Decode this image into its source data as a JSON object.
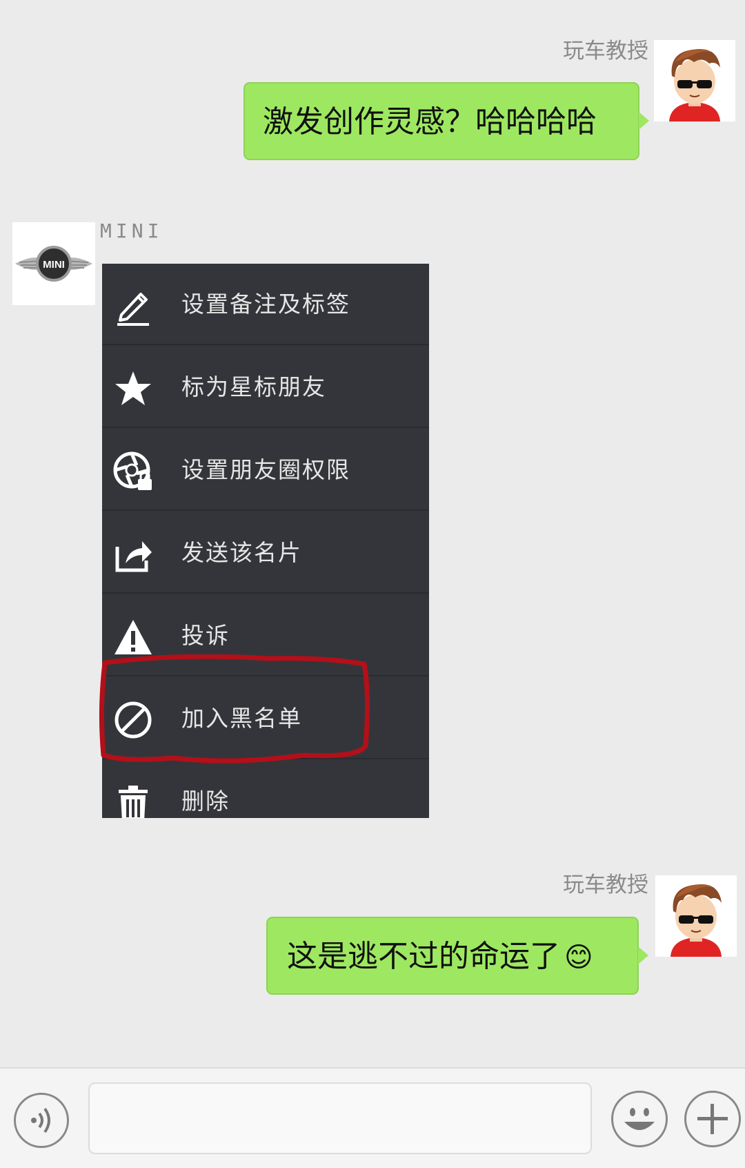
{
  "messages": [
    {
      "sender": "玩车教授",
      "text": "激发创作灵感？哈哈哈哈"
    },
    {
      "sender": "玩车教授",
      "text": "这是逃不过的命运了",
      "emoji": "😊"
    }
  ],
  "contact": {
    "name": "MINI",
    "logo_text": "MINI"
  },
  "context_menu": {
    "items": [
      {
        "label": "设置备注及标签",
        "icon": "edit-pencil-icon"
      },
      {
        "label": "标为星标朋友",
        "icon": "star-icon"
      },
      {
        "label": "设置朋友圈权限",
        "icon": "moments-privacy-icon"
      },
      {
        "label": "发送该名片",
        "icon": "share-icon"
      },
      {
        "label": "投诉",
        "icon": "warning-icon"
      },
      {
        "label": "加入黑名单",
        "icon": "block-icon",
        "highlighted": true
      },
      {
        "label": "删除",
        "icon": "trash-icon"
      }
    ]
  },
  "input_bar": {
    "voice_icon": "voice-icon",
    "emoji_icon": "emoji-icon",
    "plus_icon": "plus-icon",
    "text_value": ""
  },
  "colors": {
    "background": "#ebebeb",
    "bubble_green": "#9de860",
    "menu_bg": "#34353a",
    "highlight_red": "#b3101a"
  }
}
